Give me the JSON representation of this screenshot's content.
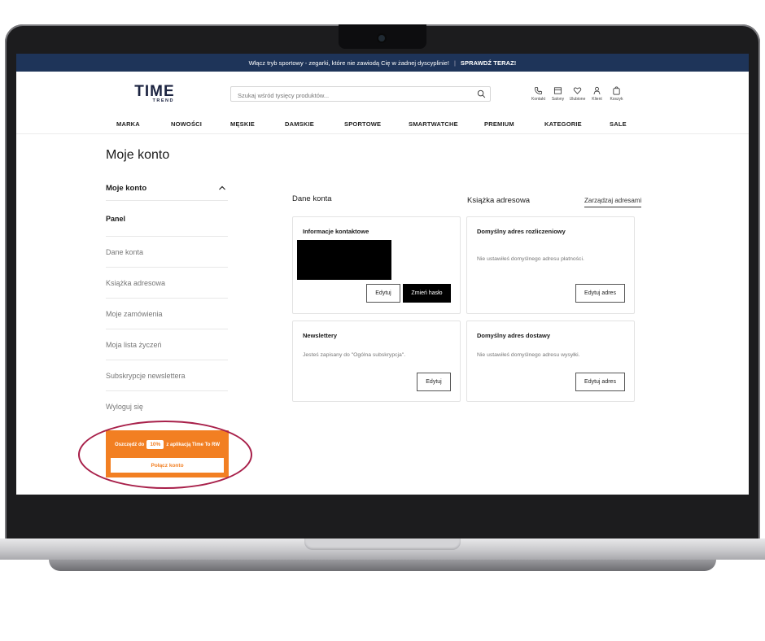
{
  "promo": {
    "text": "Włącz tryb sportowy - zegarki, które nie zawiodą Cię w żadnej dyscyplinie!",
    "separator": "|",
    "cta": "SPRAWDŹ TERAZ!"
  },
  "logo": {
    "main": "TIME",
    "sub": "TREND"
  },
  "search": {
    "placeholder": "Szukaj wśród tysięcy produktów..."
  },
  "header_icons": [
    {
      "label": "Kontakt",
      "icon": "phone-icon"
    },
    {
      "label": "Salony",
      "icon": "store-icon"
    },
    {
      "label": "Ulubione",
      "icon": "heart-icon"
    },
    {
      "label": "Klient",
      "icon": "user-icon"
    },
    {
      "label": "Koszyk",
      "icon": "bag-icon"
    }
  ],
  "nav": [
    "MARKA",
    "NOWOŚCI",
    "MĘSKIE",
    "DAMSKIE",
    "SPORTOWE",
    "SMARTWATCHE",
    "PREMIUM",
    "KATEGORIE",
    "SALE"
  ],
  "page_title": "Moje konto",
  "sidebar": {
    "header": "Moje konto",
    "items": [
      "Panel",
      "Dane konta",
      "Książka adresowa",
      "Moje zamówienia",
      "Moja lista życzeń",
      "Subskrypcje newslettera",
      "Wyloguj się"
    ]
  },
  "app_promo": {
    "prefix": "Oszczędź do",
    "highlight": "10%",
    "suffix": "z aplikacją Time To RW",
    "button": "Połącz konto"
  },
  "account": {
    "title": "Dane konta",
    "contact": {
      "title": "Informacje kontaktowe",
      "edit": "Edytuj",
      "change_password": "Zmień hasło"
    },
    "newsletter": {
      "title": "Newslettery",
      "text": "Jesteś zapisany do \"Ogólna subskrypcja\".",
      "edit": "Edytuj"
    }
  },
  "addresses": {
    "title": "Książka adresowa",
    "manage": "Zarządzaj adresami",
    "billing": {
      "title": "Domyślny adres rozliczeniowy",
      "text": "Nie ustawiłeś domyślnego adresu płatności.",
      "edit": "Edytuj adres"
    },
    "shipping": {
      "title": "Domyślny adres dostawy",
      "text": "Nie ustawiłeś domyślnego adresu wysyłki.",
      "edit": "Edytuj adres"
    }
  },
  "colors": {
    "navy": "#1e3459",
    "orange": "#f27f22",
    "ring": "#a8204a"
  }
}
